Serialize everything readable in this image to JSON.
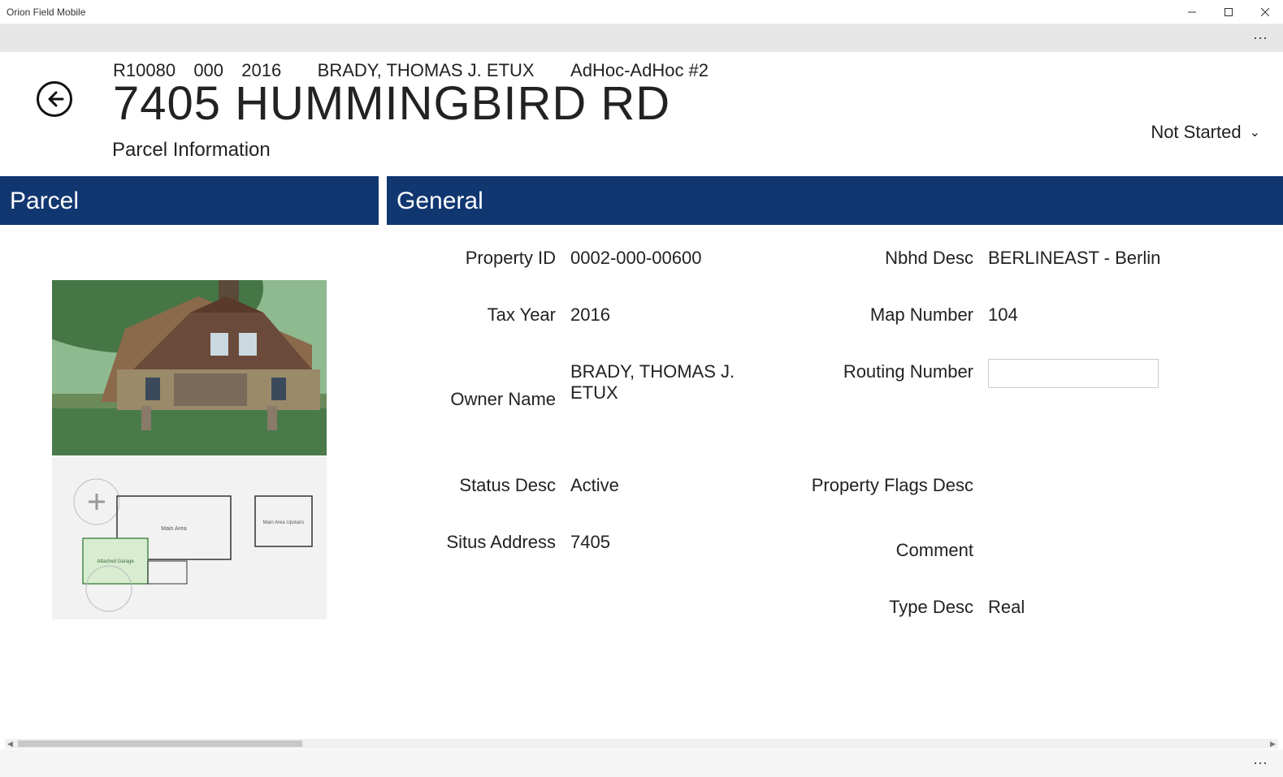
{
  "window": {
    "title": "Orion Field Mobile"
  },
  "header": {
    "record_id": "R10080",
    "record_sub": "000",
    "year": "2016",
    "owner": "BRADY, THOMAS J. ETUX",
    "adhoc": "AdHoc-AdHoc #2",
    "title": "7405 HUMMINGBIRD RD",
    "status": "Not Started",
    "section_label": "Parcel Information"
  },
  "panels": {
    "parcel": {
      "title": "Parcel"
    },
    "general": {
      "title": "General"
    }
  },
  "general": {
    "labels": {
      "property_id": "Property ID",
      "tax_year": "Tax Year",
      "owner_name": "Owner Name",
      "situs_address": "Situs Address",
      "status_desc": "Status Desc",
      "type_desc": "Type Desc",
      "nbhd_desc": "Nbhd Desc",
      "map_number": "Map Number",
      "routing_number": "Routing Number",
      "property_flags_desc": "Property Flags Desc",
      "comment": "Comment"
    },
    "values": {
      "property_id": "0002-000-00600",
      "tax_year": "2016",
      "owner_name": "BRADY, THOMAS J. ETUX",
      "situs_address": "7405",
      "status_desc": "Active",
      "type_desc": "Real",
      "nbhd_desc": "BERLINEAST - Berlin",
      "map_number": "104",
      "routing_number": "",
      "property_flags_desc": "",
      "comment": ""
    }
  }
}
